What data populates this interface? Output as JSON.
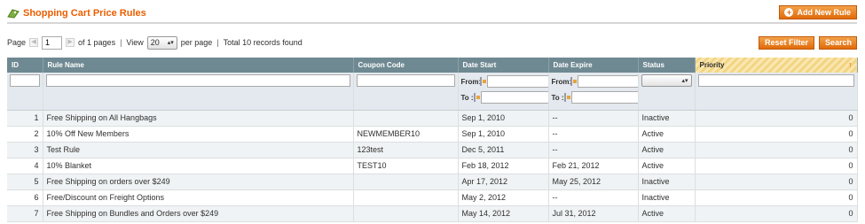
{
  "header": {
    "title": "Shopping Cart Price Rules",
    "add_button": "Add New Rule"
  },
  "pager": {
    "page_label": "Page",
    "page_value": "1",
    "of_pages": "of 1 pages",
    "view_label": "View",
    "per_page_value": "20",
    "per_page_label": "per page",
    "total": "Total 10 records found"
  },
  "actions": {
    "reset_filter": "Reset Filter",
    "search": "Search"
  },
  "grid": {
    "columns": [
      "ID",
      "Rule Name",
      "Coupon Code",
      "Date Start",
      "Date Expire",
      "Status",
      "Priority"
    ],
    "filter": {
      "from_label": "From:",
      "to_label": "To :"
    },
    "rows": [
      {
        "id": "1",
        "name": "Free Shipping on All Hangbags",
        "coupon": "",
        "start": "Sep 1, 2010",
        "expire": "--",
        "status": "Inactive",
        "priority": "0"
      },
      {
        "id": "2",
        "name": "10% Off New Members",
        "coupon": "NEWMEMBER10",
        "start": "Sep 1, 2010",
        "expire": "--",
        "status": "Active",
        "priority": "0"
      },
      {
        "id": "3",
        "name": "Test Rule",
        "coupon": "123test",
        "start": "Dec 5, 2011",
        "expire": "--",
        "status": "Active",
        "priority": "0"
      },
      {
        "id": "4",
        "name": "10% Blanket",
        "coupon": "TEST10",
        "start": "Feb 18, 2012",
        "expire": "Feb 21, 2012",
        "status": "Active",
        "priority": "0"
      },
      {
        "id": "5",
        "name": "Free Shipping on orders over $249",
        "coupon": "",
        "start": "Apr 17, 2012",
        "expire": "May 25, 2012",
        "status": "Inactive",
        "priority": "0"
      },
      {
        "id": "6",
        "name": "Free/Discount on Freight Options",
        "coupon": "",
        "start": "May 2, 2012",
        "expire": "--",
        "status": "Inactive",
        "priority": "0"
      },
      {
        "id": "7",
        "name": "Free Shipping on Bundles and Orders over $249",
        "coupon": "",
        "start": "May 14, 2012",
        "expire": "Jul 31, 2012",
        "status": "Active",
        "priority": "0"
      }
    ]
  },
  "icons": {
    "title_icon": "cart-rule-icon",
    "add_icon": "plus-circle-icon",
    "sort_icon": "sort-arrow-up-icon",
    "calendar_icon": "calendar-icon"
  },
  "colors": {
    "accent": "#eb5e00",
    "button": "#e06b09",
    "header_bg": "#6f8992",
    "filter_bg": "#e3e9ee"
  }
}
